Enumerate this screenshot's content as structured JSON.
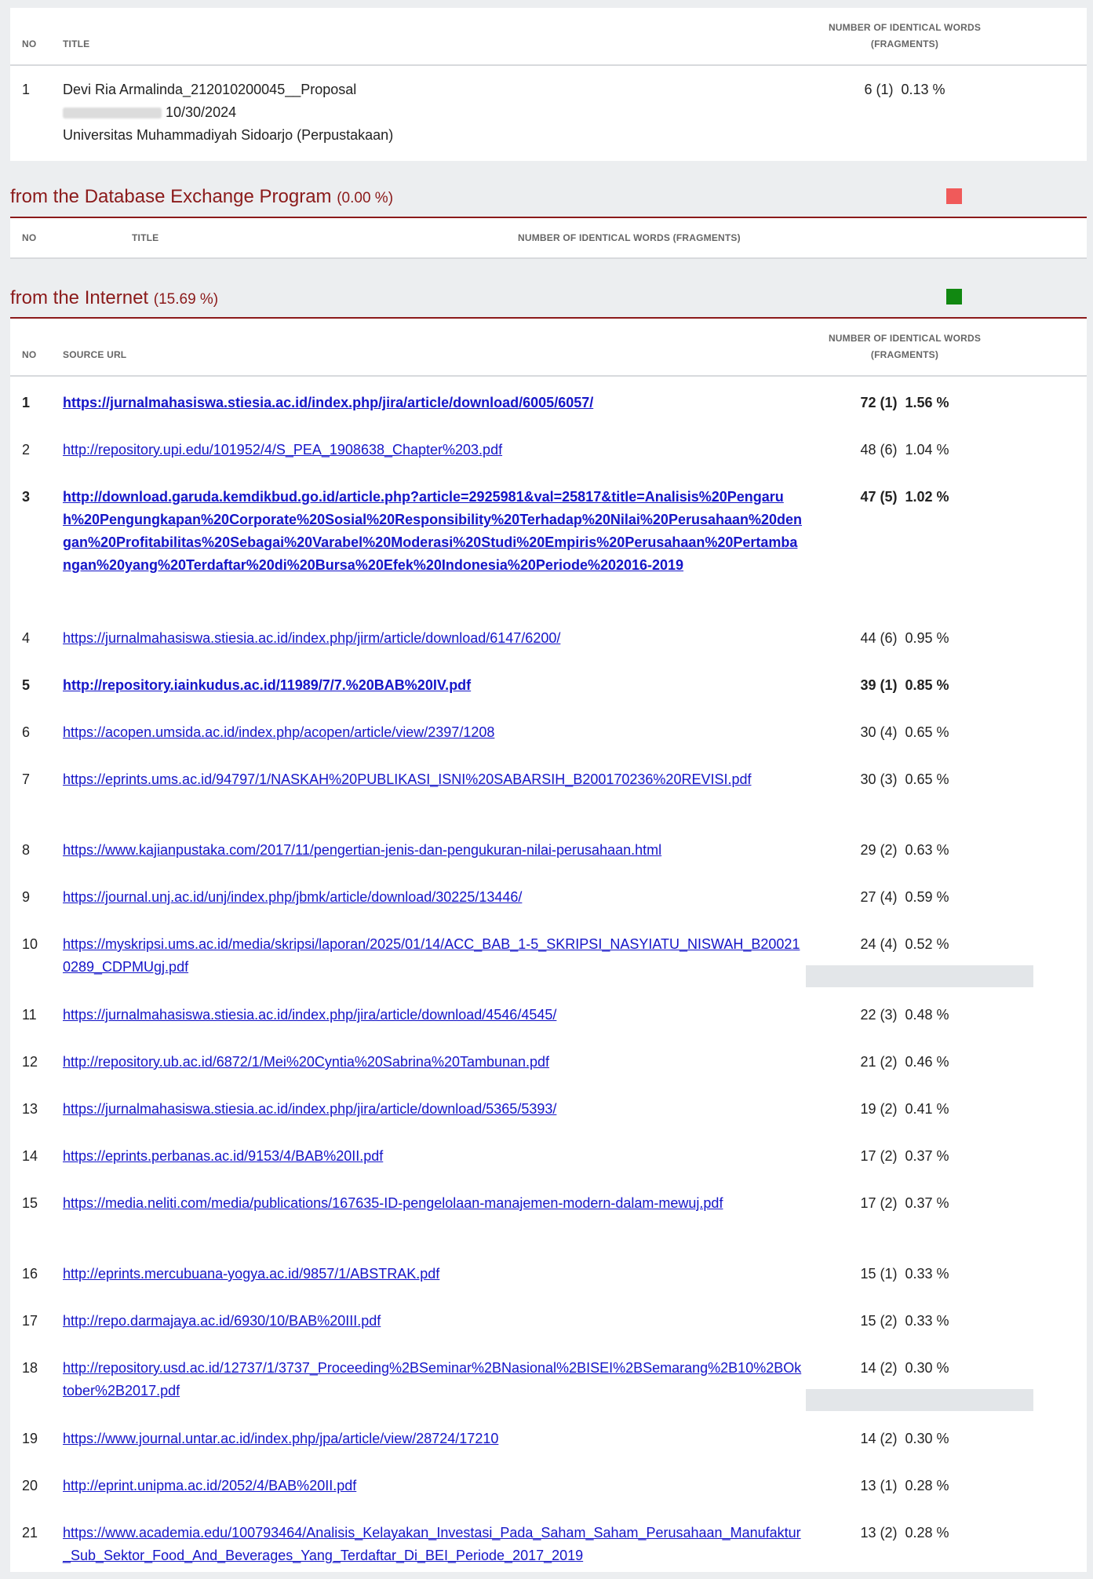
{
  "top_table": {
    "headers": {
      "no": "NO",
      "title": "TITLE",
      "count_line1": "NUMBER OF IDENTICAL WORDS",
      "count_line2": "(FRAGMENTS)"
    },
    "row": {
      "no": "1",
      "title": "Devi Ria Armalinda_212010200045__Proposal",
      "date": "10/30/2024",
      "institution": "Universitas Muhammadiyah Sidoarjo (Perpustakaan)",
      "count": "6 (1)  0.13 %"
    }
  },
  "database_exchange": {
    "title": "from the Database Exchange Program",
    "percent": "(0.00 %)",
    "color": "#f05a5a",
    "headers": {
      "no": "NO",
      "title": "TITLE",
      "count": "NUMBER OF IDENTICAL WORDS (FRAGMENTS)"
    }
  },
  "internet": {
    "title": "from the Internet",
    "percent": "(15.69 %)",
    "color": "#118811",
    "headers": {
      "no": "NO",
      "url": "SOURCE URL",
      "count_line1": "NUMBER OF IDENTICAL WORDS",
      "count_line2": "(FRAGMENTS)"
    },
    "rows": [
      {
        "no": "1",
        "url": "https://jurnalmahasiswa.stiesia.ac.id/index.php/jira/article/download/6005/6057/",
        "count": "72 (1)  1.56 %",
        "bold": true
      },
      {
        "no": "2",
        "url": "http://repository.upi.edu/101952/4/S_PEA_1908638_Chapter%203.pdf",
        "count": "48 (6)  1.04 %",
        "bold": false
      },
      {
        "no": "3",
        "url": "http://download.garuda.kemdikbud.go.id/article.php?article=2925981&val=25817&title=Analisis%20Pengaruh%20Pengungkapan%20Corporate%20Sosial%20Responsibility%20Terhadap%20Nilai%20Perusahaan%20dengan%20Profitabilitas%20Sebagai%20Varabel%20Moderasi%20Studi%20Empiris%20Perusahaan%20Pertambangan%20yang%20Terdaftar%20di%20Bursa%20Efek%20Indonesia%20Periode%202016-2019",
        "count": "47 (5)  1.02 %",
        "bold": true
      },
      {
        "no": "4",
        "url": "https://jurnalmahasiswa.stiesia.ac.id/index.php/jirm/article/download/6147/6200/",
        "count": "44 (6)  0.95 %",
        "bold": false
      },
      {
        "no": "5",
        "url": "http://repository.iainkudus.ac.id/11989/7/7.%20BAB%20IV.pdf",
        "count": "39 (1)  0.85 %",
        "bold": true
      },
      {
        "no": "6",
        "url": "https://acopen.umsida.ac.id/index.php/acopen/article/view/2397/1208",
        "count": "30 (4)  0.65 %",
        "bold": false
      },
      {
        "no": "7",
        "url": "https://eprints.ums.ac.id/94797/1/NASKAH%20PUBLIKASI_ISNI%20SABARSIH_B200170236%20REVISI.pdf",
        "count": "30 (3)  0.65 %",
        "bold": false
      },
      {
        "no": "8",
        "url": "https://www.kajianpustaka.com/2017/11/pengertian-jenis-dan-pengukuran-nilai-perusahaan.html",
        "count": "29 (2)  0.63 %",
        "bold": false
      },
      {
        "no": "9",
        "url": "https://journal.unj.ac.id/unj/index.php/jbmk/article/download/30225/13446/",
        "count": "27 (4)  0.59 %",
        "bold": false
      },
      {
        "no": "10",
        "url": "https://myskripsi.ums.ac.id/media/skripsi/laporan/2025/01/14/ACC_BAB_1-5_SKRIPSI_NASYIATU_NISWAH_B200210289_CDPMUgj.pdf",
        "count": "24 (4)  0.52 %",
        "bold": false
      },
      {
        "no": "11",
        "url": "https://jurnalmahasiswa.stiesia.ac.id/index.php/jira/article/download/4546/4545/",
        "count": "22 (3)  0.48 %",
        "bold": false
      },
      {
        "no": "12",
        "url": "http://repository.ub.ac.id/6872/1/Mei%20Cyntia%20Sabrina%20Tambunan.pdf",
        "count": "21 (2)  0.46 %",
        "bold": false
      },
      {
        "no": "13",
        "url": "https://jurnalmahasiswa.stiesia.ac.id/index.php/jira/article/download/5365/5393/",
        "count": "19 (2)  0.41 %",
        "bold": false
      },
      {
        "no": "14",
        "url": "https://eprints.perbanas.ac.id/9153/4/BAB%20II.pdf",
        "count": "17 (2)  0.37 %",
        "bold": false
      },
      {
        "no": "15",
        "url": "https://media.neliti.com/media/publications/167635-ID-pengelolaan-manajemen-modern-dalam-mewuj.pdf",
        "count": "17 (2)  0.37 %",
        "bold": false
      },
      {
        "no": "16",
        "url": "http://eprints.mercubuana-yogya.ac.id/9857/1/ABSTRAK.pdf",
        "count": "15 (1)  0.33 %",
        "bold": false
      },
      {
        "no": "17",
        "url": "http://repo.darmajaya.ac.id/6930/10/BAB%20III.pdf",
        "count": "15 (2)  0.33 %",
        "bold": false
      },
      {
        "no": "18",
        "url": "http://repository.usd.ac.id/12737/1/3737_Proceeding%2BSeminar%2BNasional%2BISEI%2BSemarang%2B10%2BOktober%2B2017.pdf",
        "count": "14 (2)  0.30 %",
        "bold": false
      },
      {
        "no": "19",
        "url": "https://www.journal.untar.ac.id/index.php/jpa/article/view/28724/17210",
        "count": "14 (2)  0.30 %",
        "bold": false
      },
      {
        "no": "20",
        "url": "http://eprint.unipma.ac.id/2052/4/BAB%20II.pdf",
        "count": "13 (1)  0.28 %",
        "bold": false
      },
      {
        "no": "21",
        "url": "https://www.academia.edu/100793464/Analisis_Kelayakan_Investasi_Pada_Saham_Saham_Perusahaan_Manufaktur_Sub_Sektor_Food_And_Beverages_Yang_Terdaftar_Di_BEI_Periode_2017_2019",
        "count": "13 (2)  0.28 %",
        "bold": false
      }
    ]
  }
}
